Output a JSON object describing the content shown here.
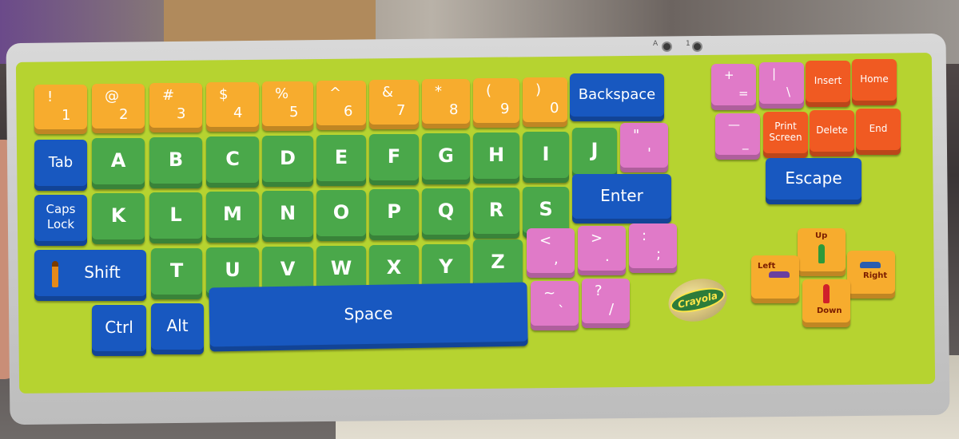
{
  "keyboard": {
    "led_labels": [
      "A",
      "1"
    ],
    "brand": "Crayola",
    "keys": {
      "k1": {
        "top": "!",
        "bottom": "1"
      },
      "k2": {
        "top": "@",
        "bottom": "2"
      },
      "k3": {
        "top": "#",
        "bottom": "3"
      },
      "k4": {
        "top": "$",
        "bottom": "4"
      },
      "k5": {
        "top": "%",
        "bottom": "5"
      },
      "k6": {
        "top": "^",
        "bottom": "6"
      },
      "k7": {
        "top": "&",
        "bottom": "7"
      },
      "k8": {
        "top": "*",
        "bottom": "8"
      },
      "k9": {
        "top": "(",
        "bottom": "9"
      },
      "k0": {
        "top": ")",
        "bottom": "0"
      },
      "backspace": "Backspace",
      "tab": "Tab",
      "caps_lock": "Caps\nLock",
      "shift": "Shift",
      "ctrl": "Ctrl",
      "alt": "Alt",
      "space": "Space",
      "enter": "Enter",
      "A": "A",
      "B": "B",
      "C": "C",
      "D": "D",
      "E": "E",
      "F": "F",
      "G": "G",
      "H": "H",
      "I": "I",
      "J": "J",
      "K": "K",
      "L": "L",
      "M": "M",
      "N": "N",
      "O": "O",
      "P": "P",
      "Q": "Q",
      "R": "R",
      "S": "S",
      "T": "T",
      "U": "U",
      "V": "V",
      "W": "W",
      "X": "X",
      "Y": "Y",
      "Z": "Z",
      "quote": {
        "top": "\"",
        "bottom": "'"
      },
      "comma": {
        "top": "<",
        "bottom": ","
      },
      "period": {
        "top": ">",
        "bottom": "."
      },
      "semicolon": {
        "top": ":",
        "bottom": ";"
      },
      "tilde": {
        "top": "~",
        "bottom": "`"
      },
      "slash": {
        "top": "?",
        "bottom": "/"
      },
      "equals": {
        "top": "+",
        "bottom": "="
      },
      "backslash": {
        "top": "|",
        "bottom": "\\"
      },
      "minus": {
        "top": "—",
        "bottom": "_"
      },
      "insert": "Insert",
      "home": "Home",
      "print_screen": "Print\nScreen",
      "delete": "Delete",
      "end": "End",
      "escape": "Escape",
      "up": "Up",
      "down": "Down",
      "left": "Left",
      "right": "Right"
    }
  },
  "colors": {
    "plate": "#b6d330",
    "orange": "#f7ac2e",
    "green": "#4aa84a",
    "blue": "#1858c0",
    "pink": "#e07ac8",
    "red": "#f05a22"
  }
}
